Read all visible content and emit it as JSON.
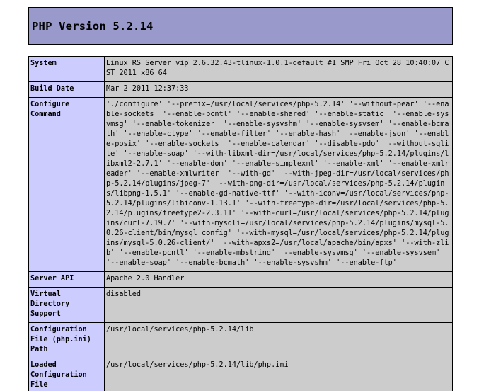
{
  "header": {
    "title": "PHP Version 5.2.14",
    "colors": {
      "header_bg": "#9999cc",
      "label_bg": "#ccccff",
      "value_bg": "#cccccc",
      "border": "#000000"
    }
  },
  "info_table": {
    "rows": [
      {
        "label": "System",
        "value": "Linux RS_Server_vip 2.6.32.43-tlinux-1.0.1-default #1 SMP Fri Oct 28 10:40:07 CST 2011 x86_64"
      },
      {
        "label": "Build Date",
        "value": "Mar 2 2011 12:37:33"
      },
      {
        "label": "Configure Command",
        "value": "'./configure' '--prefix=/usr/local/services/php-5.2.14' '--without-pear' '--enable-sockets' '--enable-pcntl' '--enable-shared' '--enable-static' '--enable-sysvmsg' '--enable-tokenizer' '--enable-sysvshm' '--enable-sysvsem' '--enable-bcmath' '--enable-ctype' '--enable-filter' '--enable-hash' '--enable-json' '--enable-posix' '--enable-sockets' '--enable-calendar' '--disable-pdo' '--without-sqlite' '--enable-soap' '--with-libxml-dir=/usr/local/services/php-5.2.14/plugins/libxml2-2.7.1' '--enable-dom' '--enable-simplexml' '--enable-xml' '--enable-xmlreader' '--enable-xmlwriter' '--with-gd' '--with-jpeg-dir=/usr/local/services/php-5.2.14/plugins/jpeg-7' '--with-png-dir=/usr/local/services/php-5.2.14/plugins/libpng-1.5.1' '--enable-gd-native-ttf' '--with-iconv=/usr/local/services/php-5.2.14/plugins/libiconv-1.13.1' '--with-freetype-dir=/usr/local/services/php-5.2.14/plugins/freetype2-2.3.11' '--with-curl=/usr/local/services/php-5.2.14/plugins/curl-7.19.7' '--with-mysqli=/usr/local/services/php-5.2.14/plugins/mysql-5.0.26-client/bin/mysql_config' '--with-mysql=/usr/local/services/php-5.2.14/plugins/mysql-5.0.26-client/' '--with-apxs2=/usr/local/apache/bin/apxs' '--with-zlib' '--enable-pcntl' '--enable-mbstring' '--enable-sysvmsg' '--enable-sysvsem' '--enable-soap' '--enable-bcmath' '--enable-sysvshm' '--enable-ftp'"
      },
      {
        "label": "Server API",
        "value": "Apache 2.0 Handler"
      },
      {
        "label": "Virtual Directory Support",
        "value": "disabled"
      },
      {
        "label": "Configuration File (php.ini) Path",
        "value": "/usr/local/services/php-5.2.14/lib"
      },
      {
        "label": "Loaded Configuration File",
        "value": "/usr/local/services/php-5.2.14/lib/php.ini"
      }
    ]
  }
}
